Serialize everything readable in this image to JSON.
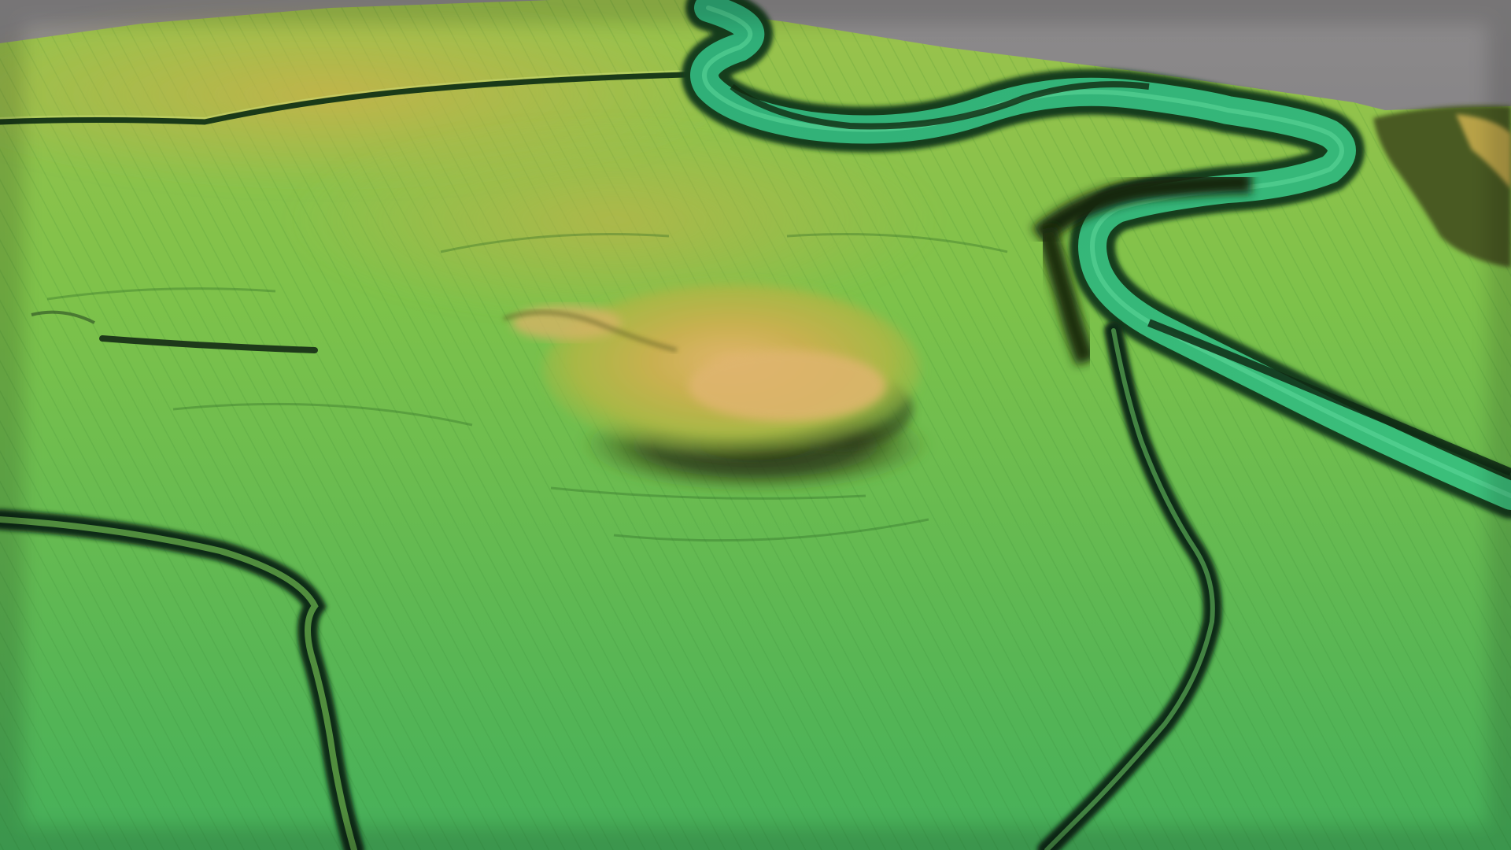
{
  "scene": {
    "kind": "3D shaded terrain elevation model",
    "palette": {
      "sky": "#6d6c70",
      "sky_light": "#8a8888",
      "low": "#3fae5a",
      "mid": "#7fc14a",
      "high": "#b9b04a",
      "peak": "#d9b06a",
      "river": "#33b07a",
      "ditch": "#0f2a14",
      "shadow": "#1a2410"
    },
    "features": [
      {
        "id": "hill",
        "type": "hillfort mound"
      },
      {
        "id": "river",
        "type": "meandering river channel"
      },
      {
        "id": "ditch-left",
        "type": "field boundary ditch"
      },
      {
        "id": "ditch-right",
        "type": "field boundary ditch"
      },
      {
        "id": "track-top",
        "type": "hollow way"
      },
      {
        "id": "escarpment-right",
        "type": "wooded escarpment"
      }
    ]
  }
}
